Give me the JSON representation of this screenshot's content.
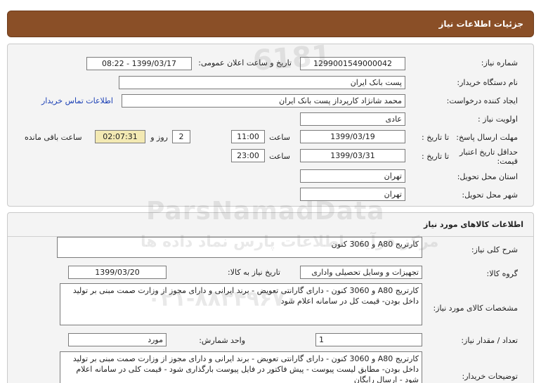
{
  "header": {
    "title": "جزئیات اطلاعات نیاز"
  },
  "need_info": {
    "need_number_label": "شماره نیاز:",
    "need_number": "1299001549000042",
    "announce_label": "تاریخ و ساعت اعلان عمومی:",
    "announce_value": "1399/03/17 - 08:22",
    "buyer_org_label": "نام دستگاه خریدار:",
    "buyer_org": "پست بانک ایران",
    "creator_label": "ایجاد کننده درخواست:",
    "creator": "محمد شانژاد کارپرداز پست بانک ایران",
    "contact_link": "اطلاعات تماس خریدار",
    "priority_label": "اولویت نیاز :",
    "priority": "عادی",
    "response_deadline_label": "مهلت ارسال پاسخ:",
    "until_date_label": "تا تاریخ :",
    "response_date": "1399/03/19",
    "time_label": "ساعت",
    "response_time": "11:00",
    "days_value": "2",
    "days_label": "روز و",
    "remaining_time": "02:07:31",
    "remaining_label": "ساعت باقی مانده",
    "price_validity_label": "حداقل تاریخ اعتبار قیمت:",
    "price_date": "1399/03/31",
    "price_time": "23:00",
    "province_label": "استان محل تحویل:",
    "province": "تهران",
    "city_label": "شهر محل تحویل:",
    "city": "تهران"
  },
  "goods_info": {
    "section_title": "اطلاعات کالاهای مورد نیاز",
    "general_desc_label": "شرح کلی نیاز:",
    "general_desc": "کارتریج A80 و 3060 کنون",
    "group_label": "گروه کالا:",
    "group": "تجهیزات و وسایل تحصیلی واداری",
    "need_date_label": "تاریخ نیاز به کالا:",
    "need_date": "1399/03/20",
    "specs_label": "مشخصات کالای مورد نیاز:",
    "specs": "کارتریج A80 و 3060 کنون - دارای گارانتی تعویض - برند ایرانی و دارای مجوز از وزارت صمت مبنی بر تولید داخل بودن- قیمت کل در  سامانه اعلام شود",
    "unit_label": "واحد شمارش:",
    "unit": "مورد",
    "quantity_label": "تعداد / مقدار نیاز:",
    "quantity": "1",
    "buyer_notes_label": "توضیحات خریدار:",
    "buyer_notes": "کارتریج A80 و 3060 کنون - دارای گارانتی تعویض - برند ایرانی و دارای مجوز از وزارت صمت مبنی بر تولید داخل بودن- مطابق لیست پیوست - پیش فاکتور در فایل پیوست بارگذاری شود - قیمت کلی در سامانه اعلام شود - ارسال رایگان"
  },
  "watermark": {
    "brand": "ParsNamadData",
    "tagline": "مرکز فرآیند اطلاعات پارس نماد داده ها",
    "phone": "۰۲۱-۸۸۳۴۹۶۷۰"
  }
}
